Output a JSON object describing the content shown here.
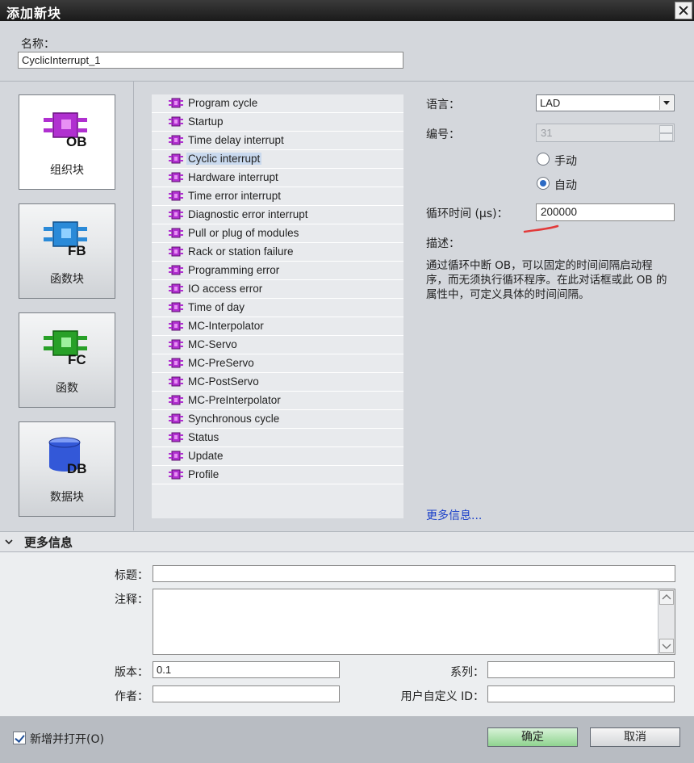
{
  "window": {
    "title": "添加新块"
  },
  "name_field": {
    "label": "名称：",
    "value": "CyclicInterrupt_1"
  },
  "block_types": [
    {
      "key": "ob",
      "badge": "OB",
      "label": "组织块",
      "color": "#b030d0",
      "selected": true
    },
    {
      "key": "fb",
      "badge": "FB",
      "label": "函数块",
      "color": "#2a8ad8",
      "selected": false
    },
    {
      "key": "fc",
      "badge": "FC",
      "label": "函数",
      "color": "#28a028",
      "selected": false
    },
    {
      "key": "db",
      "badge": "DB",
      "label": "数据块",
      "color": "#3358d8",
      "selected": false
    }
  ],
  "ob_types": [
    "Program cycle",
    "Startup",
    "Time delay interrupt",
    "Cyclic interrupt",
    "Hardware interrupt",
    "Time error interrupt",
    "Diagnostic error interrupt",
    "Pull or plug of modules",
    "Rack or station failure",
    "Programming error",
    "IO access error",
    "Time of day",
    "MC-Interpolator",
    "MC-Servo",
    "MC-PreServo",
    "MC-PostServo",
    "MC-PreInterpolator",
    "Synchronous cycle",
    "Status",
    "Update",
    "Profile"
  ],
  "selected_ob_index": 3,
  "properties": {
    "language_label": "语言：",
    "language_value": "LAD",
    "number_label": "编号：",
    "number_value": "31",
    "manual_label": "手动",
    "auto_label": "自动",
    "numbering_mode": "auto",
    "cycle_time_label": "循环时间 (μs)：",
    "cycle_time_value": "200000",
    "description_label": "描述：",
    "description_text": "通过循环中断 OB，可以固定的时间间隔启动程序，而无须执行循环程序。在此对话框或此 OB 的属性中，可定义具体的时间间隔。",
    "more_info_link": "更多信息..."
  },
  "more_info": {
    "header": "更多信息",
    "title_label": "标题：",
    "title_value": "",
    "comment_label": "注释：",
    "comment_value": "",
    "version_label": "版本：",
    "version_value": "0.1",
    "family_label": "系列：",
    "family_value": "",
    "author_label": "作者：",
    "author_value": "",
    "user_id_label": "用户自定义 ID：",
    "user_id_value": ""
  },
  "footer": {
    "open_checkbox_label": "新增并打开(O)",
    "open_checked": true,
    "ok_label": "确定",
    "cancel_label": "取消"
  },
  "colors": {
    "ob_icon": "#b030d0",
    "accent_link": "#1a3fc9",
    "ok_button": "#8fd48f",
    "annotation_mark": "#e23a3a"
  }
}
